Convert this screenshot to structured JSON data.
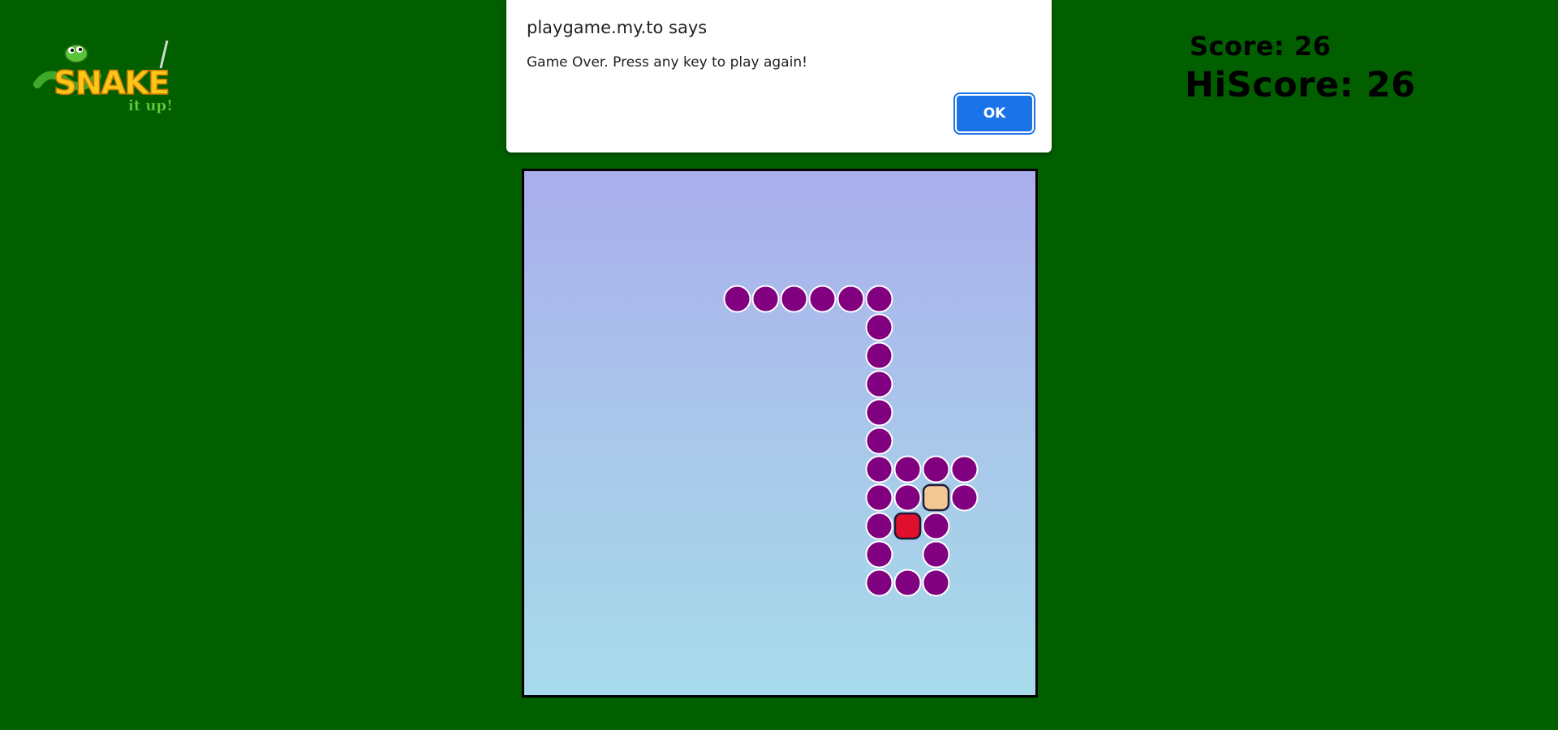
{
  "header": {
    "logo_text": "SNAKE",
    "logo_subtext": "it up!",
    "score_label": "Score: 26",
    "hiscore_label": "HiScore: 26"
  },
  "alert": {
    "title": "playgame.my.to says",
    "message": "Game Over. Press any key to play again!",
    "ok_label": "OK"
  },
  "game": {
    "grid_cols": 18,
    "grid_rows": 18,
    "snake_color": "#800080",
    "food_color": "#f2c894",
    "head_color": "#e0102c",
    "snake_cells": [
      [
        7,
        4
      ],
      [
        8,
        4
      ],
      [
        9,
        4
      ],
      [
        10,
        4
      ],
      [
        11,
        4
      ],
      [
        12,
        4
      ],
      [
        12,
        5
      ],
      [
        12,
        6
      ],
      [
        12,
        7
      ],
      [
        12,
        8
      ],
      [
        12,
        9
      ],
      [
        12,
        10
      ],
      [
        13,
        10
      ],
      [
        14,
        10
      ],
      [
        15,
        10
      ],
      [
        12,
        11
      ],
      [
        13,
        11
      ],
      [
        15,
        11
      ],
      [
        12,
        12
      ],
      [
        14,
        12
      ],
      [
        12,
        13
      ],
      [
        14,
        13
      ],
      [
        12,
        14
      ],
      [
        13,
        14
      ],
      [
        14,
        14
      ]
    ],
    "food_cell": [
      14,
      11
    ],
    "head_cell": [
      13,
      12
    ]
  }
}
